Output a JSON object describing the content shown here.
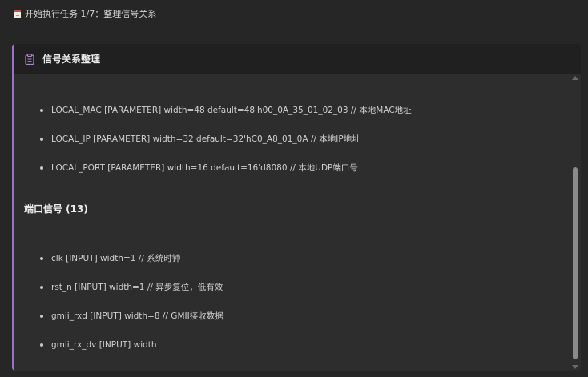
{
  "task": {
    "icon": "notepad-icon",
    "text": "开始执行任务 1/7：整理信号关系"
  },
  "panel": {
    "icon": "clipboard-icon",
    "title": "信号关系整理",
    "accent_color": "#a070c8",
    "parameters": [
      "LOCAL_MAC [PARAMETER] width=48 default=48'h00_0A_35_01_02_03 // 本地MAC地址",
      "LOCAL_IP [PARAMETER] width=32 default=32'hC0_A8_01_0A // 本地IP地址",
      "LOCAL_PORT [PARAMETER] width=16 default=16'd8080 // 本地UDP端口号"
    ],
    "port_section_heading": "端口信号 (13)",
    "ports": [
      "clk [INPUT] width=1 // 系统时钟",
      "rst_n [INPUT] width=1 // 异步复位，低有效",
      "gmii_rxd [INPUT] width=8 // GMII接收数据",
      "gmii_rx_dv [INPUT] width"
    ]
  },
  "scrollbar": {
    "up_icon": "scroll-up-arrow-icon",
    "down_icon": "scroll-down-arrow-icon"
  }
}
